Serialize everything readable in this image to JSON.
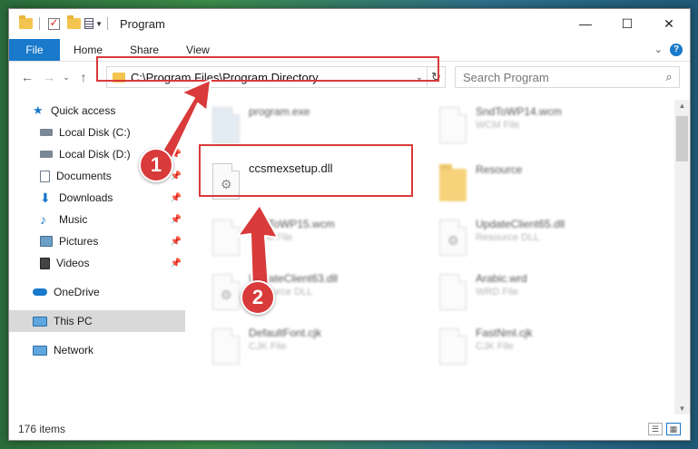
{
  "window": {
    "title": "Program",
    "controls": {
      "minimize": "—",
      "maximize": "☐",
      "close": "✕"
    }
  },
  "ribbon": {
    "tabs": [
      {
        "label": "File",
        "active": true
      },
      {
        "label": "Home"
      },
      {
        "label": "Share"
      },
      {
        "label": "View"
      }
    ],
    "help": "?"
  },
  "address": {
    "path": "C:\\Program Files\\Program Directory"
  },
  "search": {
    "placeholder": "Search Program"
  },
  "sidebar": {
    "quick_access": "Quick access",
    "items": [
      {
        "label": "Local Disk (C:)",
        "icon": "drive-icon"
      },
      {
        "label": "Local Disk (D:)",
        "icon": "drive-icon"
      },
      {
        "label": "Documents",
        "icon": "documents-icon"
      },
      {
        "label": "Downloads",
        "icon": "downloads-icon"
      },
      {
        "label": "Music",
        "icon": "music-icon"
      },
      {
        "label": "Pictures",
        "icon": "pictures-icon"
      },
      {
        "label": "Videos",
        "icon": "videos-icon"
      }
    ],
    "onedrive": "OneDrive",
    "this_pc": "This PC",
    "network": "Network"
  },
  "files": [
    {
      "name": "program.exe",
      "type": ""
    },
    {
      "name": "SndToWP14.wcm",
      "type": "WCM File"
    },
    {
      "name": "ccsmexsetup.dll",
      "type": ""
    },
    {
      "name": "Resource",
      "type": ""
    },
    {
      "name": "SndToWP15.wcm",
      "type": "WCM File"
    },
    {
      "name": "UpdateClient65.dll",
      "type": "Resource DLL"
    },
    {
      "name": "UpdateClient63.dll",
      "type": "Resource DLL"
    },
    {
      "name": "Arabic.wrd",
      "type": "WRD File"
    },
    {
      "name": "DefaultFont.cjk",
      "type": "CJK File"
    },
    {
      "name": "FastNml.cjk",
      "type": "CJK File"
    }
  ],
  "status": {
    "count": "176 items"
  },
  "annotations": {
    "step1": "1",
    "step2": "2"
  },
  "colors": {
    "accent": "#1979ca",
    "highlight": "#d93a3a"
  }
}
